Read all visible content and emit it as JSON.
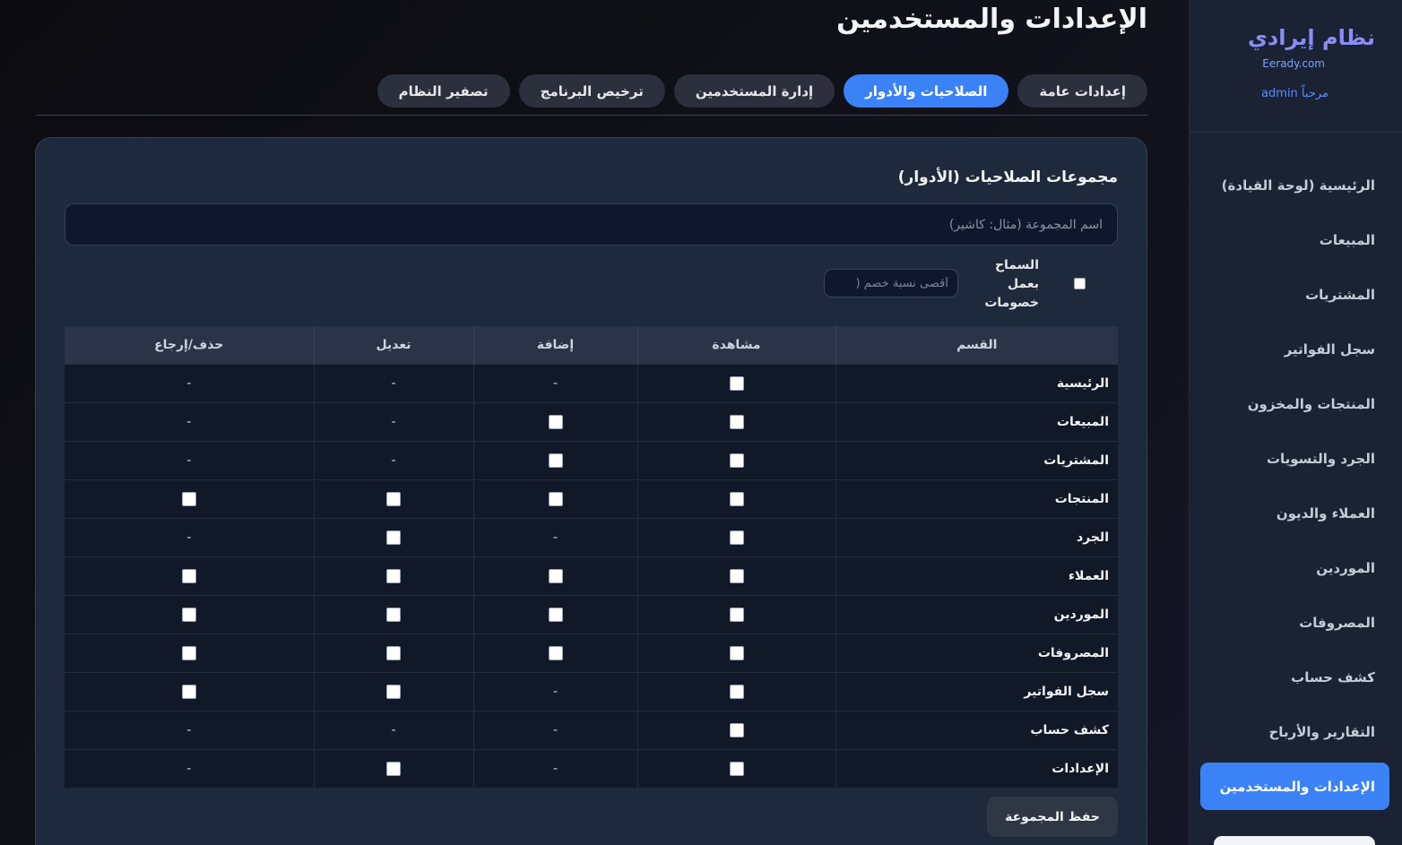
{
  "sidebar": {
    "brand": "نظام إيرادي",
    "url": "Eerady.com",
    "welcome": "مرحباً admin",
    "items": [
      {
        "label": "الرئيسية (لوحة القيادة)",
        "active": false
      },
      {
        "label": "المبيعات",
        "active": false
      },
      {
        "label": "المشتريات",
        "active": false
      },
      {
        "label": "سجل الفواتير",
        "active": false
      },
      {
        "label": "المنتجات والمخزون",
        "active": false
      },
      {
        "label": "الجرد والتسويات",
        "active": false
      },
      {
        "label": "العملاء والديون",
        "active": false
      },
      {
        "label": "الموردين",
        "active": false
      },
      {
        "label": "المصروفات",
        "active": false
      },
      {
        "label": "كشف حساب",
        "active": false
      },
      {
        "label": "التقارير والأرباح",
        "active": false
      },
      {
        "label": "الإعدادات والمستخدمين",
        "active": true
      }
    ]
  },
  "header": {
    "title": "الإعدادات والمستخدمين",
    "tabs": [
      {
        "label": "إعدادات عامة",
        "active": false
      },
      {
        "label": "الصلاحيات والأدوار",
        "active": true
      },
      {
        "label": "إدارة المستخدمين",
        "active": false
      },
      {
        "label": "ترخيص البرنامج",
        "active": false
      },
      {
        "label": "تصفير النظام",
        "active": false
      }
    ]
  },
  "card": {
    "title": "مجموعات الصلاحيات (الأدوار)",
    "group_name_placeholder": "اسم المجموعة (مثال: كاشير)",
    "group_name_value": "",
    "discount_label": "السماح بعمل خصومات",
    "discount_checked": false,
    "max_discount_placeholder": "أقصى نسبة خصم (",
    "save_label": "حفظ المجموعة"
  },
  "permissions": {
    "headers": [
      "القسم",
      "مشاهدة",
      "إضافة",
      "تعديل",
      "حذف/إرجاع"
    ],
    "rows": [
      {
        "section": "الرئيسية",
        "cells": [
          "check",
          "-",
          "-",
          "-"
        ]
      },
      {
        "section": "المبيعات",
        "cells": [
          "check",
          "check",
          "-",
          "-"
        ]
      },
      {
        "section": "المشتريات",
        "cells": [
          "check",
          "check",
          "-",
          "-"
        ]
      },
      {
        "section": "المنتجات",
        "cells": [
          "check",
          "check",
          "check",
          "check"
        ]
      },
      {
        "section": "الجرد",
        "cells": [
          "check",
          "-",
          "check",
          "-"
        ]
      },
      {
        "section": "العملاء",
        "cells": [
          "check",
          "check",
          "check",
          "check"
        ]
      },
      {
        "section": "الموردين",
        "cells": [
          "check",
          "check",
          "check",
          "check"
        ]
      },
      {
        "section": "المصروفات",
        "cells": [
          "check",
          "check",
          "check",
          "check"
        ]
      },
      {
        "section": "سجل الفواتير",
        "cells": [
          "check",
          "-",
          "check",
          "check"
        ]
      },
      {
        "section": "كشف حساب",
        "cells": [
          "check",
          "-",
          "-",
          "-"
        ]
      },
      {
        "section": "الإعدادات",
        "cells": [
          "check",
          "-",
          "check",
          "-"
        ]
      }
    ]
  }
}
